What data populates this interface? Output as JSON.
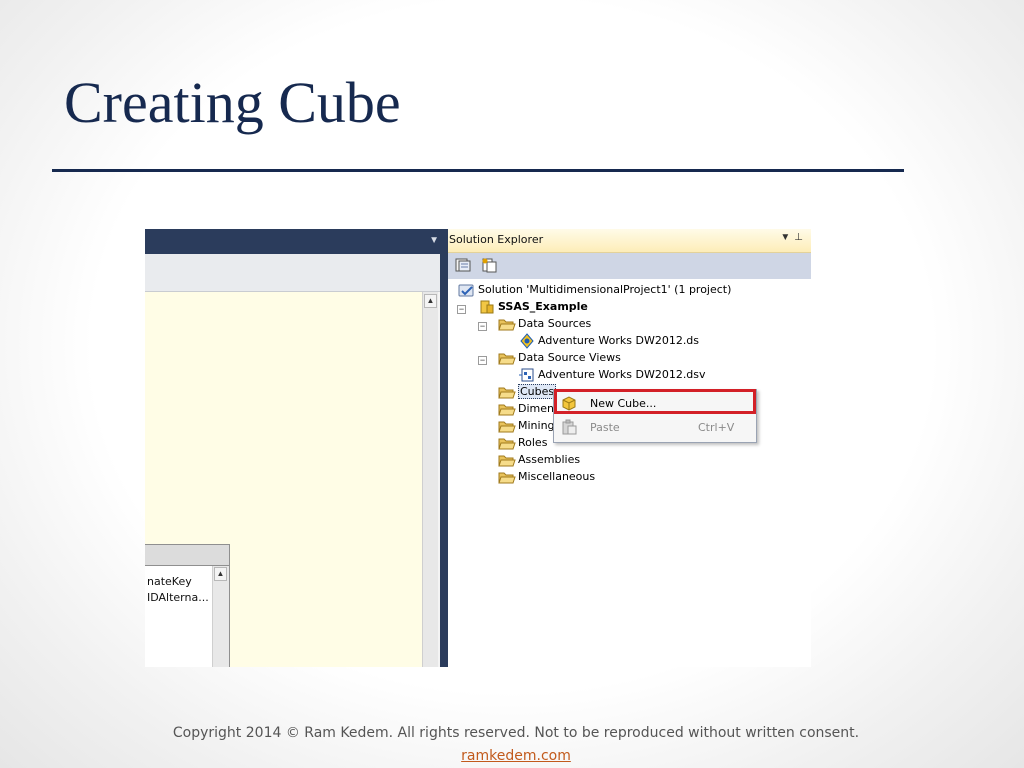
{
  "slide": {
    "title": "Creating Cube",
    "copyright": "Copyright 2014 © Ram Kedem. All rights reserved. Not to be reproduced without written consent.",
    "website": "ramkedem.com",
    "title_color": "#16294f",
    "link_color": "#c25a1c"
  },
  "editor": {
    "table_rows": [
      "nateKey",
      "IDAlterna..."
    ]
  },
  "solution_explorer": {
    "title": "Solution Explorer",
    "tree": {
      "solution": "Solution 'MultidimensionalProject1' (1 project)",
      "project": "SSAS_Example",
      "data_sources": "Data Sources",
      "data_source_item": "Adventure Works DW2012.ds",
      "data_source_views": "Data Source Views",
      "data_source_view_item": "Adventure Works DW2012.dsv",
      "cubes": "Cubes",
      "dimensions": "Dimen",
      "mining": "Mining",
      "roles": "Roles",
      "assemblies": "Assemblies",
      "miscellaneous": "Miscellaneous"
    }
  },
  "context_menu": {
    "new_cube": "New Cube...",
    "paste": "Paste",
    "paste_shortcut": "Ctrl+V",
    "highlight_color": "#d32027"
  }
}
